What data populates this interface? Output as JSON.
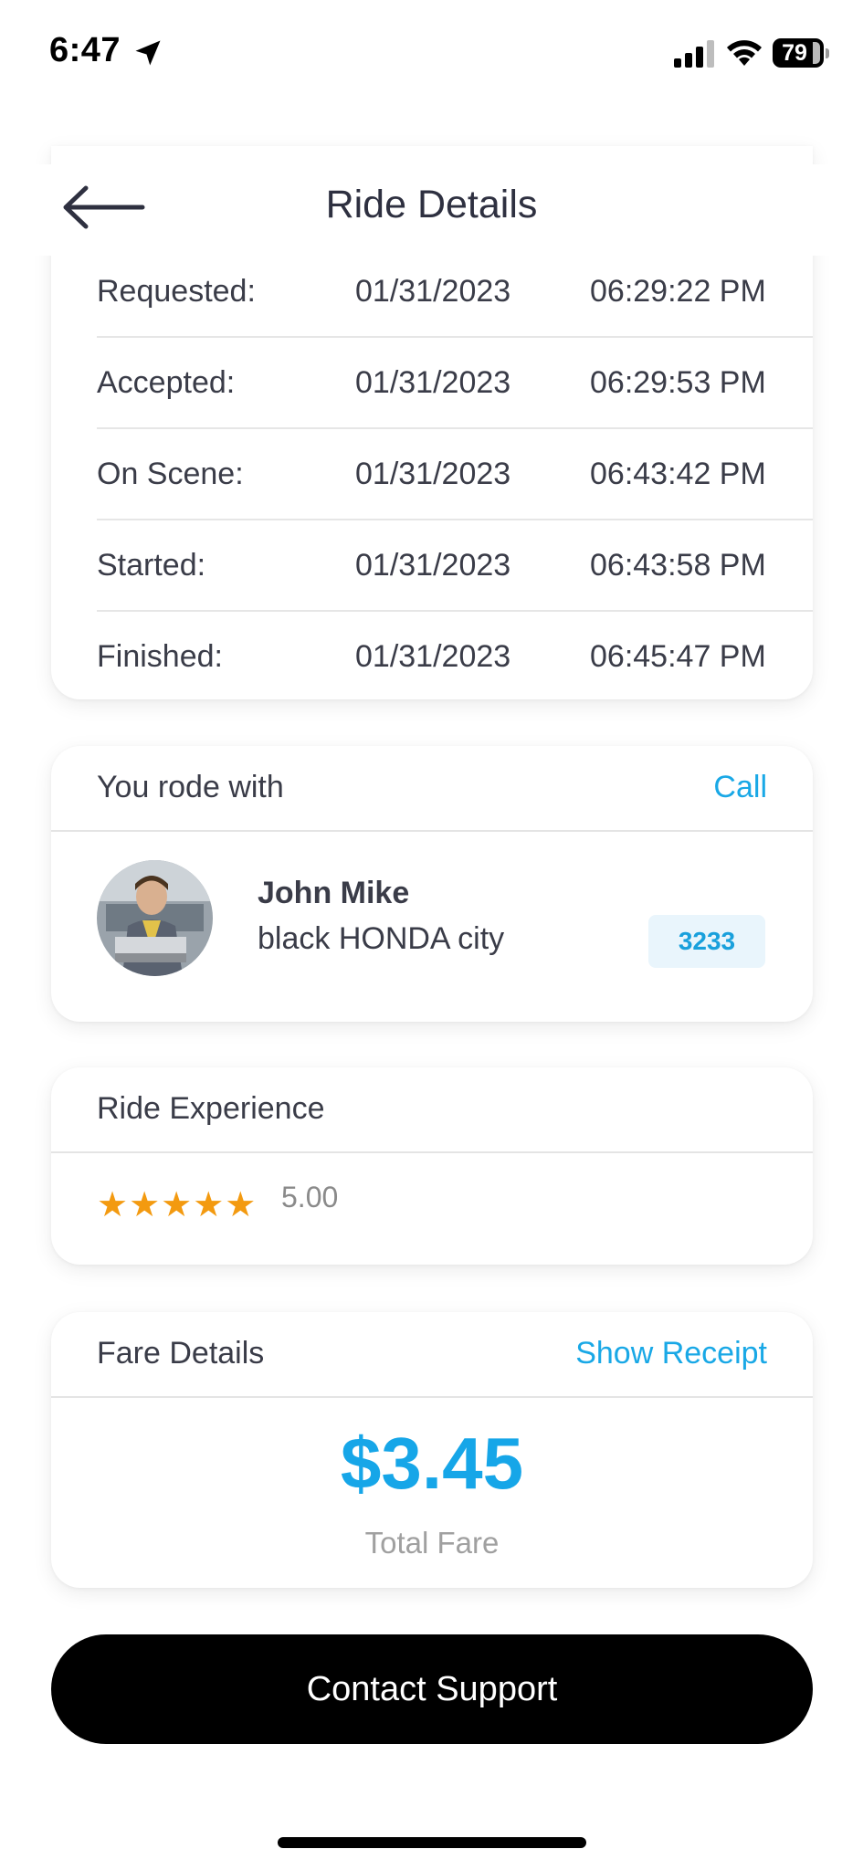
{
  "status_bar": {
    "time": "6:47",
    "battery": "79"
  },
  "header": {
    "title": "Ride Details"
  },
  "timeline": [
    {
      "label": "Requested:",
      "date": "01/31/2023",
      "time": "06:29:22 PM"
    },
    {
      "label": "Accepted:",
      "date": "01/31/2023",
      "time": "06:29:53 PM"
    },
    {
      "label": "On Scene:",
      "date": "01/31/2023",
      "time": "06:43:42 PM"
    },
    {
      "label": "Started:",
      "date": "01/31/2023",
      "time": "06:43:58 PM"
    },
    {
      "label": "Finished:",
      "date": "01/31/2023",
      "time": "06:45:47 PM"
    }
  ],
  "driver_card": {
    "title": "You rode with",
    "call_label": "Call",
    "driver_name": "John Mike",
    "vehicle": "black HONDA city",
    "plate": "3233"
  },
  "experience_card": {
    "title": "Ride Experience",
    "stars": "★★★★★",
    "rating": "5.00",
    "rating_value": 5
  },
  "fare_card": {
    "title": "Fare Details",
    "receipt_label": "Show Receipt",
    "amount": "$3.45",
    "amount_label": "Total Fare"
  },
  "support_button": {
    "label": "Contact Support"
  },
  "colors": {
    "accent": "#16a6e8",
    "star": "#f39a10",
    "button": "#000000"
  }
}
